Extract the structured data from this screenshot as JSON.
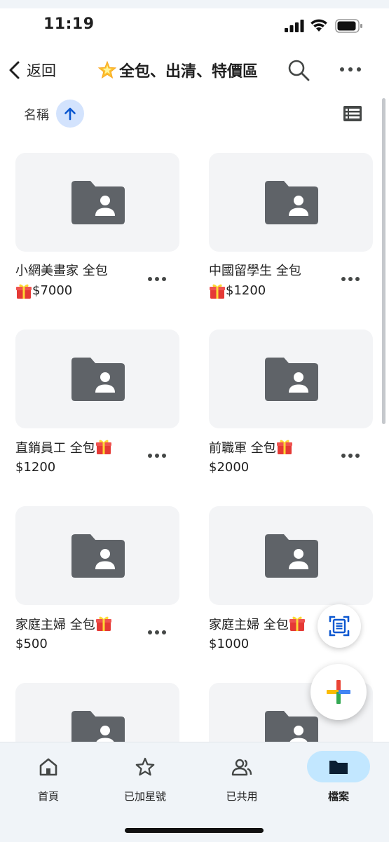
{
  "status_bar": {
    "time": "11:19"
  },
  "header": {
    "back_label": "返回",
    "title": "全包、出清、特價區"
  },
  "sort": {
    "label": "名稱"
  },
  "items": [
    {
      "name": "小網美畫家 全包",
      "name_gift": false,
      "price": "$7000",
      "price_gift": true
    },
    {
      "name": "中國留學生 全包",
      "name_gift": false,
      "price": "$1200",
      "price_gift": true
    },
    {
      "name": "直銷員工 全包",
      "name_gift": true,
      "price": "$1200",
      "price_gift": false
    },
    {
      "name": "前職軍 全包",
      "name_gift": true,
      "price": "$2000",
      "price_gift": false
    },
    {
      "name": "家庭主婦 全包",
      "name_gift": true,
      "price": "$500",
      "price_gift": false
    },
    {
      "name": "家庭主婦 全包",
      "name_gift": true,
      "price": "$1000",
      "price_gift": false
    }
  ],
  "nav": [
    {
      "label": "首頁",
      "icon": "home-icon",
      "active": false
    },
    {
      "label": "已加星號",
      "icon": "star-icon",
      "active": false
    },
    {
      "label": "已共用",
      "icon": "people-icon",
      "active": false
    },
    {
      "label": "檔案",
      "icon": "folder-icon",
      "active": true
    }
  ],
  "colors": {
    "folder": "#5f6368",
    "accent": "#0b57d0",
    "active_pill": "#c2e7ff",
    "thumb_bg": "#f3f4f6"
  }
}
